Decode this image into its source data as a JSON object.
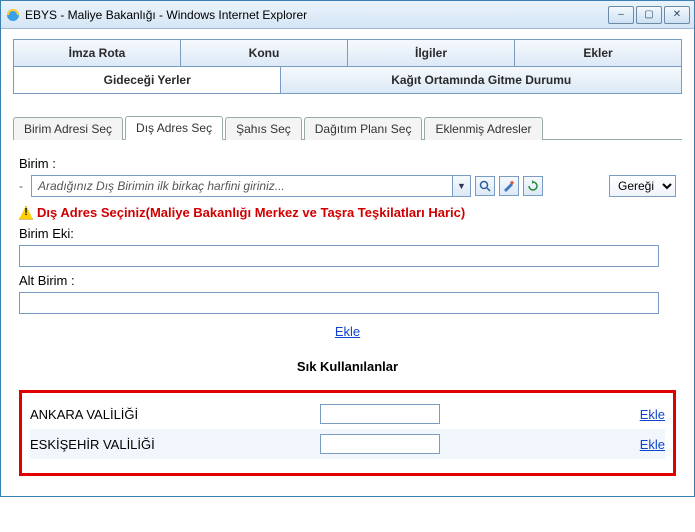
{
  "window": {
    "title": "EBYS - Maliye Bakanlığı - Windows Internet Explorer"
  },
  "tabs_top": {
    "t1": "İmza Rota",
    "t2": "Konu",
    "t3": "İlgiler",
    "t4": "Ekler"
  },
  "tabs_second": {
    "t1": "Gideceği Yerler",
    "t2": "Kağıt Ortamında Gitme Durumu"
  },
  "subtabs": {
    "s1": "Birim Adresi Seç",
    "s2": "Dış Adres Seç",
    "s3": "Şahıs Seç",
    "s4": "Dağıtım Planı Seç",
    "s5": "Eklenmiş Adresler"
  },
  "form": {
    "birim_label": "Birim  :",
    "birim_placeholder": "Aradığınız Dış Birimin ilk birkaç harfini giriniz...",
    "geregi_label": "Gereği",
    "warning_text": "Dış Adres Seçiniz(Maliye Bakanlığı Merkez ve Taşra Teşkilatları Haric)",
    "birim_eki_label": "Birim Eki:",
    "birim_eki_value": "",
    "alt_birim_label": "Alt Birim :",
    "alt_birim_value": "",
    "ekle_link": "Ekle"
  },
  "favorites": {
    "header": "Sık Kullanılanlar",
    "items": [
      {
        "name": "ANKARA VALİLİĞİ",
        "value": "",
        "action": "Ekle"
      },
      {
        "name": "ESKİŞEHİR VALİLİĞİ",
        "value": "",
        "action": "Ekle"
      }
    ]
  }
}
